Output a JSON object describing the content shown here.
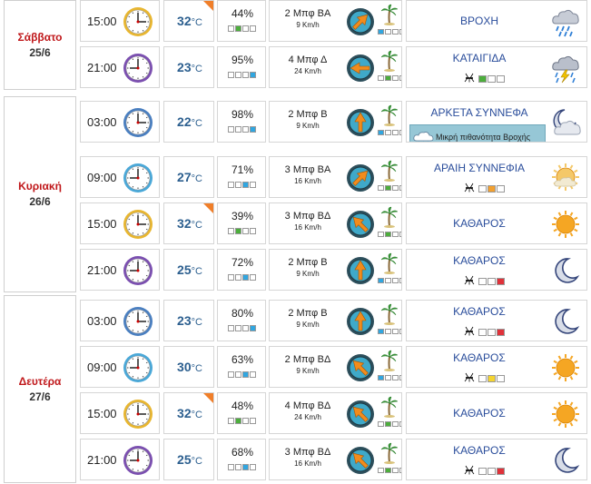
{
  "days": [
    {
      "name": "Σάββατο",
      "date": "25/6"
    },
    {
      "name": "Κυριακή",
      "date": "26/6"
    },
    {
      "name": "Δευτέρα",
      "date": "27/6"
    }
  ],
  "temp_unit": "°C",
  "colors": {
    "day_name": "#c0181b",
    "temperature": "#2c5f8f",
    "sky_text": "#2a4d9b",
    "hot_flag": "#f07f2a",
    "bar_green": "#4cae3c",
    "bar_blue": "#31a6e0",
    "bar_red": "#e0323a",
    "bar_orange": "#f2a030",
    "bar_yellow": "#f4d430"
  },
  "rows": [
    {
      "time": "15:00",
      "clock_color": "#e8b630",
      "hand_hour": 3,
      "temp": "32",
      "hot": true,
      "humidity": "44%",
      "hum_level": 2,
      "hum_color": "#4cae3c",
      "wind": "2 Μπφ ΒΑ",
      "wind_speed": "9 Km/h",
      "wind_dir_deg": 225,
      "wind_level": 1,
      "wind_level_color": "#31a6e0",
      "sky": "ΒΡΟΧΗ",
      "sky_icon": "rain-icon",
      "pollen": null,
      "rain_note": null
    },
    {
      "time": "21:00",
      "clock_color": "#7b4fb0",
      "hand_hour": 9,
      "temp": "23",
      "hot": false,
      "humidity": "95%",
      "hum_level": 4,
      "hum_color": "#31a6e0",
      "wind": "4 Μπφ Δ",
      "wind_speed": "24 Km/h",
      "wind_dir_deg": 90,
      "wind_level": 2,
      "wind_level_color": "#4cae3c",
      "sky": "ΚΑΤΑΙΓΙΔΑ",
      "sky_icon": "storm-icon",
      "pollen": {
        "level": 1,
        "color": "#4cae3c"
      },
      "rain_note": null
    },
    {
      "time": "03:00",
      "clock_color": "#4a7fc0",
      "hand_hour": 3,
      "temp": "22",
      "hot": false,
      "humidity": "98%",
      "hum_level": 4,
      "hum_color": "#31a6e0",
      "wind": "2 Μπφ Β",
      "wind_speed": "9 Km/h",
      "wind_dir_deg": 180,
      "wind_level": 1,
      "wind_level_color": "#31a6e0",
      "sky": "ΑΡΚΕΤΑ ΣΥΝΝΕΦΑ",
      "sky_icon": "moon-cloud-icon",
      "pollen": null,
      "rain_note": "Μικρή πιθανότητα Βροχής"
    },
    {
      "time": "09:00",
      "clock_color": "#4aa8d8",
      "hand_hour": 9,
      "temp": "27",
      "hot": false,
      "humidity": "71%",
      "hum_level": 3,
      "hum_color": "#31a6e0",
      "wind": "3 Μπφ ΒΑ",
      "wind_speed": "16 Km/h",
      "wind_dir_deg": 225,
      "wind_level": 2,
      "wind_level_color": "#4cae3c",
      "sky": "ΑΡΑΙΗ ΣΥΝΝΕΦΙΑ",
      "sky_icon": "sun-cloud-icon",
      "pollen": {
        "level": 2,
        "color": "#f2a030"
      },
      "rain_note": null
    },
    {
      "time": "15:00",
      "clock_color": "#e8b630",
      "hand_hour": 3,
      "temp": "32",
      "hot": true,
      "humidity": "39%",
      "hum_level": 2,
      "hum_color": "#4cae3c",
      "wind": "3 Μπφ ΒΔ",
      "wind_speed": "16 Km/h",
      "wind_dir_deg": 135,
      "wind_level": 2,
      "wind_level_color": "#4cae3c",
      "sky": "ΚΑΘΑΡΟΣ",
      "sky_icon": "sun-icon",
      "pollen": null,
      "rain_note": null
    },
    {
      "time": "21:00",
      "clock_color": "#7b4fb0",
      "hand_hour": 9,
      "temp": "25",
      "hot": false,
      "humidity": "72%",
      "hum_level": 3,
      "hum_color": "#31a6e0",
      "wind": "2 Μπφ Β",
      "wind_speed": "9 Km/h",
      "wind_dir_deg": 180,
      "wind_level": 1,
      "wind_level_color": "#31a6e0",
      "sky": "ΚΑΘΑΡΟΣ",
      "sky_icon": "moon-icon",
      "pollen": {
        "level": 3,
        "color": "#e0323a"
      },
      "rain_note": null
    },
    {
      "time": "03:00",
      "clock_color": "#4a7fc0",
      "hand_hour": 3,
      "temp": "23",
      "hot": false,
      "humidity": "80%",
      "hum_level": 4,
      "hum_color": "#31a6e0",
      "wind": "2 Μπφ Β",
      "wind_speed": "9 Km/h",
      "wind_dir_deg": 180,
      "wind_level": 1,
      "wind_level_color": "#31a6e0",
      "sky": "ΚΑΘΑΡΟΣ",
      "sky_icon": "moon-icon",
      "pollen": {
        "level": 3,
        "color": "#e0323a"
      },
      "rain_note": null
    },
    {
      "time": "09:00",
      "clock_color": "#4aa8d8",
      "hand_hour": 9,
      "temp": "30",
      "hot": false,
      "humidity": "63%",
      "hum_level": 3,
      "hum_color": "#31a6e0",
      "wind": "2 Μπφ ΒΔ",
      "wind_speed": "9 Km/h",
      "wind_dir_deg": 135,
      "wind_level": 1,
      "wind_level_color": "#31a6e0",
      "sky": "ΚΑΘΑΡΟΣ",
      "sky_icon": "sun-icon",
      "pollen": {
        "level": 2,
        "color": "#f4d430"
      },
      "rain_note": null
    },
    {
      "time": "15:00",
      "clock_color": "#e8b630",
      "hand_hour": 3,
      "temp": "32",
      "hot": true,
      "humidity": "48%",
      "hum_level": 2,
      "hum_color": "#4cae3c",
      "wind": "4 Μπφ ΒΔ",
      "wind_speed": "24 Km/h",
      "wind_dir_deg": 135,
      "wind_level": 2,
      "wind_level_color": "#4cae3c",
      "sky": "ΚΑΘΑΡΟΣ",
      "sky_icon": "sun-icon",
      "pollen": null,
      "rain_note": null
    },
    {
      "time": "21:00",
      "clock_color": "#7b4fb0",
      "hand_hour": 9,
      "temp": "25",
      "hot": false,
      "humidity": "68%",
      "hum_level": 3,
      "hum_color": "#31a6e0",
      "wind": "3 Μπφ ΒΔ",
      "wind_speed": "16 Km/h",
      "wind_dir_deg": 135,
      "wind_level": 2,
      "wind_level_color": "#4cae3c",
      "sky": "ΚΑΘΑΡΟΣ",
      "sky_icon": "moon-icon",
      "pollen": {
        "level": 3,
        "color": "#e0323a"
      },
      "rain_note": null
    }
  ]
}
